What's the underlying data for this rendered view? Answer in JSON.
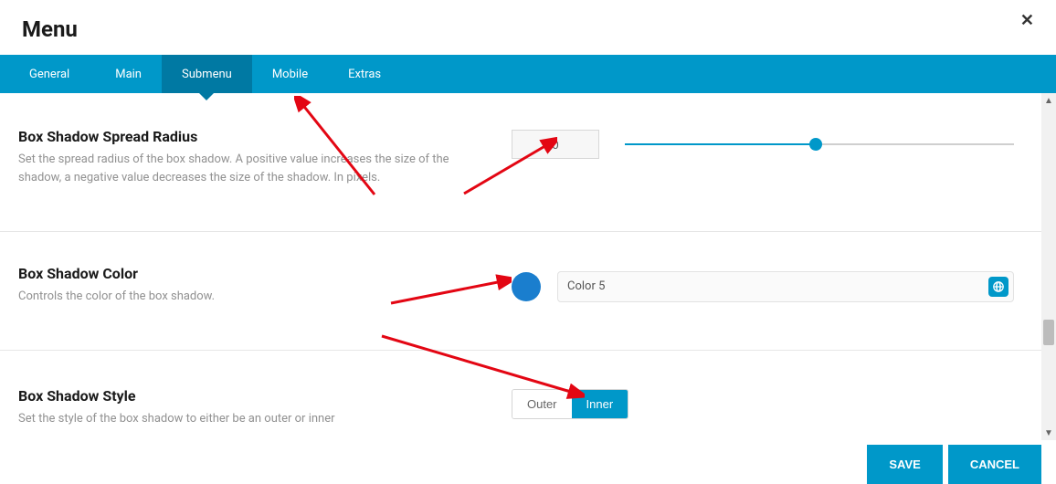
{
  "header": {
    "title": "Menu"
  },
  "tabs": [
    {
      "label": "General"
    },
    {
      "label": "Main"
    },
    {
      "label": "Submenu"
    },
    {
      "label": "Mobile"
    },
    {
      "label": "Extras"
    }
  ],
  "settings": {
    "spread": {
      "title": "Box Shadow Spread Radius",
      "desc": "Set the spread radius of the box shadow. A positive value increases the size of the shadow, a negative value decreases the size of the shadow. In pixels.",
      "value": "0"
    },
    "color": {
      "title": "Box Shadow Color",
      "desc": "Controls the color of the box shadow.",
      "value": "Color 5",
      "swatch_hex": "#1a7ece"
    },
    "style": {
      "title": "Box Shadow Style",
      "desc": "Set the style of the box shadow to either be an outer or inner",
      "options": {
        "outer": "Outer",
        "inner": "Inner"
      },
      "selected": "inner"
    }
  },
  "footer": {
    "save": "SAVE",
    "cancel": "CANCEL"
  }
}
